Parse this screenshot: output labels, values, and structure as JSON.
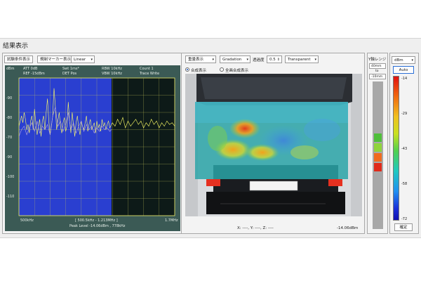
{
  "window_title": "結果表示",
  "spectrum": {
    "buttons": {
      "test_conditions": "試験条件表示",
      "marker_display": "規制マーカー表示"
    },
    "scale_select": "Linear",
    "header": {
      "att": "ATT 0dB",
      "ref": "REF -15dBm",
      "swt": "Swt 1ms*",
      "det": "DET Pos",
      "rbw": "RBW 10kHz",
      "vbw": "VBW 10kHz",
      "count": "Count 1",
      "trace": "Trace Write"
    },
    "unit": "dBm",
    "y_ticks": [
      "-90",
      "-80",
      "-70",
      "-90",
      "-100",
      "-110"
    ],
    "x_start": "500kHz",
    "x_stop": "1.7MHz",
    "band_label": "[ 500.5kHz - 1.213MHz ]",
    "peak_label": "Peak Level -14.06dBm , 778kHz"
  },
  "image_view": {
    "display_select": "重畳表示",
    "palette_select": "Gradation",
    "transparency_label": "透過度",
    "transparency_value": "0.5",
    "background_select": "Transparent",
    "radio_overlay": "合成表示",
    "radio_all": "全画合成表示",
    "status_coords": "X: ----, Y: ----, Z: ----",
    "status_level": "-14.06dBm"
  },
  "y_range": {
    "label": "Y軸レンジ",
    "top_value": "40mm",
    "separator": "to",
    "bottom_value": "-10mm",
    "layer_colors": [
      "#4fbf3a",
      "#8fd43a",
      "#f06a1e",
      "#e02a1a"
    ]
  },
  "colorbar": {
    "unit_select": "dBm",
    "auto_button": "Auto",
    "ticks": [
      "-14",
      "-29",
      "-43",
      "-58",
      "-72"
    ],
    "confirm_button": "確定"
  },
  "chart_data": {
    "type": "line",
    "xlabel": "",
    "ylabel": "dBm",
    "xlim": [
      0.5,
      1.7
    ],
    "ylim": [
      -110,
      -30
    ],
    "x_unit": "MHz",
    "highlight_band": [
      0.5005,
      1.213
    ],
    "peak": {
      "x": 0.778,
      "y": -14.06
    },
    "series": [
      {
        "color": "#ffff66",
        "x": [
          0.5,
          0.51,
          0.52,
          0.53,
          0.54,
          0.55,
          0.56,
          0.57,
          0.58,
          0.59,
          0.6,
          0.61,
          0.62,
          0.63,
          0.64,
          0.65,
          0.66,
          0.67,
          0.68,
          0.69,
          0.7,
          0.71,
          0.72,
          0.73,
          0.74,
          0.75,
          0.76,
          0.77,
          0.78,
          0.79,
          0.8,
          0.81,
          0.82,
          0.83,
          0.84,
          0.85,
          0.86,
          0.87,
          0.88,
          0.89,
          0.9,
          0.91,
          0.92,
          0.93,
          0.94,
          0.95,
          0.96,
          0.97,
          0.98,
          0.99,
          1.0,
          1.01,
          1.02,
          1.03,
          1.04,
          1.05,
          1.06,
          1.07,
          1.08,
          1.09,
          1.1,
          1.11,
          1.12,
          1.13,
          1.14,
          1.15,
          1.16,
          1.17,
          1.18,
          1.19,
          1.2,
          1.22,
          1.24,
          1.26,
          1.28,
          1.3,
          1.32,
          1.34,
          1.36,
          1.38,
          1.4,
          1.42,
          1.44,
          1.46,
          1.48,
          1.5,
          1.52,
          1.54,
          1.56,
          1.58,
          1.6,
          1.62,
          1.64,
          1.66,
          1.68,
          1.7
        ],
        "y": [
          -58,
          -55,
          -52,
          -56,
          -50,
          -54,
          -60,
          -57,
          -62,
          -55,
          -52,
          -60,
          -48,
          -56,
          -63,
          -58,
          -54,
          -64,
          -55,
          -52,
          -60,
          -50,
          -42,
          -55,
          -63,
          -58,
          -52,
          -36,
          -46,
          -60,
          -55,
          -50,
          -58,
          -62,
          -56,
          -53,
          -61,
          -58,
          -44,
          -55,
          -62,
          -50,
          -57,
          -64,
          -56,
          -52,
          -59,
          -63,
          -55,
          -58,
          -60,
          -56,
          -52,
          -61,
          -57,
          -54,
          -60,
          -58,
          -56,
          -62,
          -55,
          -59,
          -57,
          -61,
          -54,
          -58,
          -56,
          -60,
          -57,
          -55,
          -59,
          -56,
          -58,
          -54,
          -57,
          -53,
          -59,
          -55,
          -58,
          -56,
          -54,
          -57,
          -55,
          -59,
          -56,
          -58,
          -54,
          -57,
          -55,
          -59,
          -56,
          -58,
          -55,
          -57,
          -56,
          -58
        ]
      },
      {
        "color": "#b9a8e0",
        "x": [
          0.5,
          0.52,
          0.54,
          0.56,
          0.58,
          0.6,
          0.62,
          0.64,
          0.66,
          0.68,
          0.7,
          0.72,
          0.74,
          0.76,
          0.78,
          0.8,
          0.82,
          0.84,
          0.86,
          0.88,
          0.9,
          0.92,
          0.94,
          0.96,
          0.98,
          1.0,
          1.02,
          1.04,
          1.06,
          1.08,
          1.1,
          1.12,
          1.14,
          1.16,
          1.18,
          1.2,
          1.213
        ],
        "y": [
          -64,
          -60,
          -58,
          -63,
          -59,
          -56,
          -61,
          -55,
          -62,
          -58,
          -60,
          -57,
          -63,
          -52,
          -47,
          -58,
          -55,
          -61,
          -57,
          -50,
          -60,
          -56,
          -62,
          -58,
          -55,
          -61,
          -57,
          -60,
          -58,
          -62,
          -59,
          -61,
          -58,
          -60,
          -59,
          -61,
          -60
        ]
      }
    ]
  }
}
